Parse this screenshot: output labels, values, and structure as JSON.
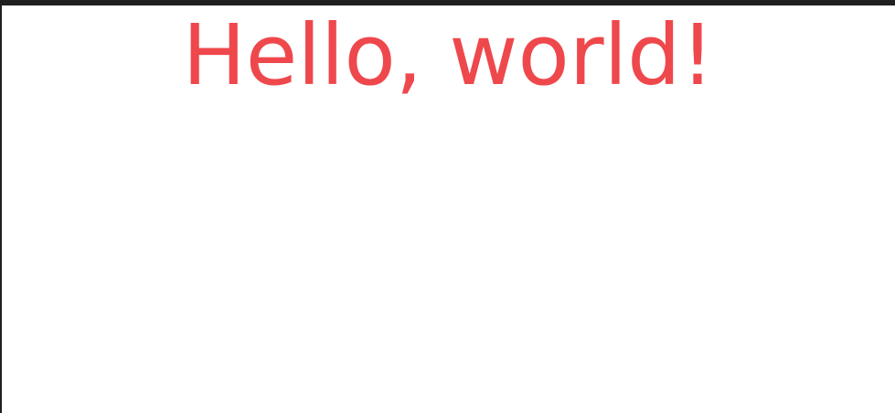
{
  "heading": {
    "text": "Hello, world!",
    "color": "#ee484c"
  },
  "window": {
    "border_color": "#202020",
    "background_color": "#ffffff"
  }
}
